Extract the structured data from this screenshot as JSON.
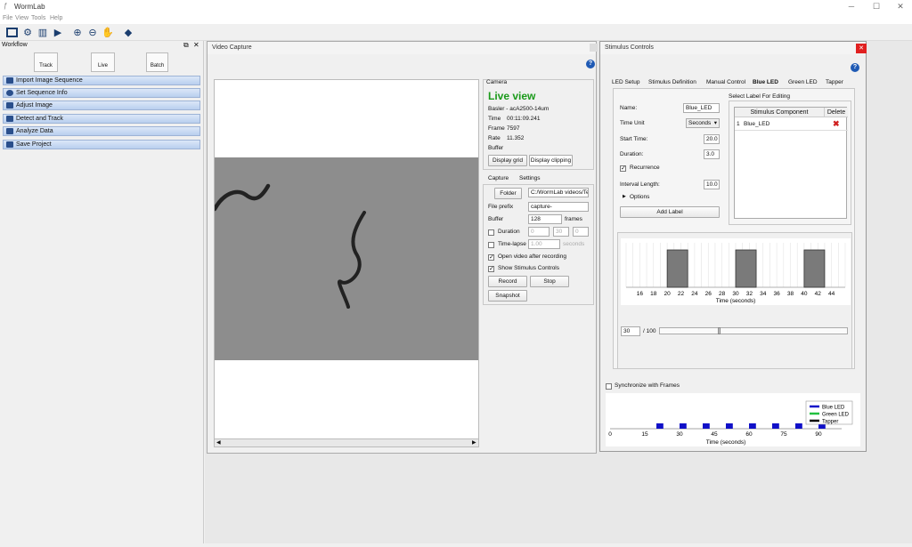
{
  "app": {
    "title": "WormLab"
  },
  "menu": [
    "File",
    "View",
    "Tools",
    "Help"
  ],
  "workflow": {
    "title": "Workflow",
    "tabs": [
      {
        "label": "Track"
      },
      {
        "label": "Live"
      },
      {
        "label": "Batch"
      }
    ],
    "steps": [
      "Import Image Sequence",
      "Set Sequence Info",
      "Adjust Image",
      "Detect and Track",
      "Analyze Data",
      "Save Project"
    ]
  },
  "video_capture": {
    "title": "Video Capture",
    "camera": {
      "group_label": "Camera",
      "status": "Live view",
      "model": "Basler - acA2500-14um",
      "time_label": "Time",
      "time_value": "00:11:09.241",
      "frame_label": "Frame",
      "frame_value": "7597",
      "rate_label": "Rate",
      "rate_value": "11.352",
      "buffer_label": "Buffer",
      "display_grid": "Display grid",
      "display_clipping": "Display clipping"
    },
    "tabs": [
      "Capture",
      "Settings"
    ],
    "capture": {
      "folder_button": "Folder",
      "folder_value": "C:/WormLab videos/Test",
      "file_prefix_label": "File prefix",
      "file_prefix_value": "capture-",
      "buffer_label": "Buffer",
      "buffer_value": "128",
      "buffer_unit": "frames",
      "duration_label": "Duration",
      "duration_h": "0",
      "duration_m": "30",
      "duration_s": "0",
      "timelapse_label": "Time-lapse",
      "timelapse_value": "1.00",
      "timelapse_unit": "seconds",
      "open_video_label": "Open video after recording",
      "show_stimulus_label": "Show Stimulus Controls",
      "record_button": "Record",
      "stop_button": "Stop",
      "snapshot_button": "Snapshot"
    }
  },
  "stimulus": {
    "title": "Stimulus Controls",
    "tabs": [
      "LED Setup",
      "Stimulus Definition",
      "Manual Control",
      "Blue LED",
      "Green LED",
      "Tapper"
    ],
    "active_tab": "Blue LED",
    "name_label": "Name:",
    "name_value": "Blue_LED",
    "time_unit_label": "Time Unit",
    "time_unit_value": "Seconds",
    "start_time_label": "Start Time:",
    "start_time_value": "20.0",
    "duration_label": "Duration:",
    "duration_value": "3.0",
    "recurrence_label": "Recurrence",
    "interval_label": "Interval Length:",
    "interval_value": "10.0",
    "options_label": "Options",
    "add_label_button": "Add Label",
    "select_label_title": "Select Label For Editing",
    "table_headers": [
      "Stimulus Component",
      "Delete"
    ],
    "table_rows": [
      {
        "index": "1",
        "name": "Blue_LED"
      }
    ],
    "position_value": "30",
    "position_total": "/ 100",
    "sync_label": "Synchronize with Frames",
    "colors": {
      "blue": "#1010c8",
      "green": "#22c040",
      "black": "#000000"
    }
  },
  "chart_data": [
    {
      "type": "bar",
      "description_scope": "pulse editor",
      "xlabel": "Time (seconds)",
      "x_ticks": [
        16,
        18,
        20,
        22,
        24,
        26,
        28,
        30,
        32,
        34,
        36,
        38,
        40,
        42,
        44
      ],
      "xlim": [
        14,
        46
      ],
      "pulses": [
        {
          "start": 20,
          "end": 23
        },
        {
          "start": 30,
          "end": 33
        },
        {
          "start": 40,
          "end": 43
        }
      ]
    },
    {
      "type": "bar",
      "xlabel": "Time (seconds)",
      "x_ticks": [
        0,
        15,
        30,
        45,
        60,
        75,
        90
      ],
      "xlim": [
        0,
        100
      ],
      "series": [
        {
          "name": "Blue LED",
          "color": "#1010c8",
          "pulses": [
            20,
            30,
            40,
            50,
            60,
            70,
            80,
            90
          ]
        },
        {
          "name": "Green LED",
          "color": "#22c040",
          "pulses": []
        },
        {
          "name": "Tapper",
          "color": "#000000",
          "pulses": []
        }
      ]
    }
  ]
}
